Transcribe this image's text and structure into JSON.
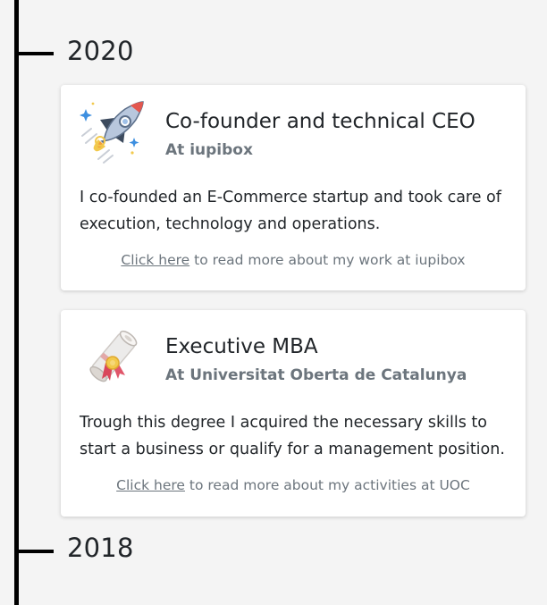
{
  "timeline": {
    "years": [
      "2020",
      "2018"
    ]
  },
  "entries": [
    {
      "icon": "rocket-icon",
      "title": "Co-founder and technical CEO",
      "subtitle": "At iupibox",
      "description": "I co-founded an E-Commerce startup and took care of execution, technology and operations.",
      "link_text": "Click here",
      "link_suffix": " to read more about my work at iupibox"
    },
    {
      "icon": "diploma-icon",
      "title": "Executive MBA",
      "subtitle": "At Universitat Oberta de Catalunya",
      "description": "Trough this degree I acquired the necessary skills to start a business or qualify for a management position.",
      "link_text": "Click here",
      "link_suffix": " to read more about my activities at UOC"
    }
  ]
}
